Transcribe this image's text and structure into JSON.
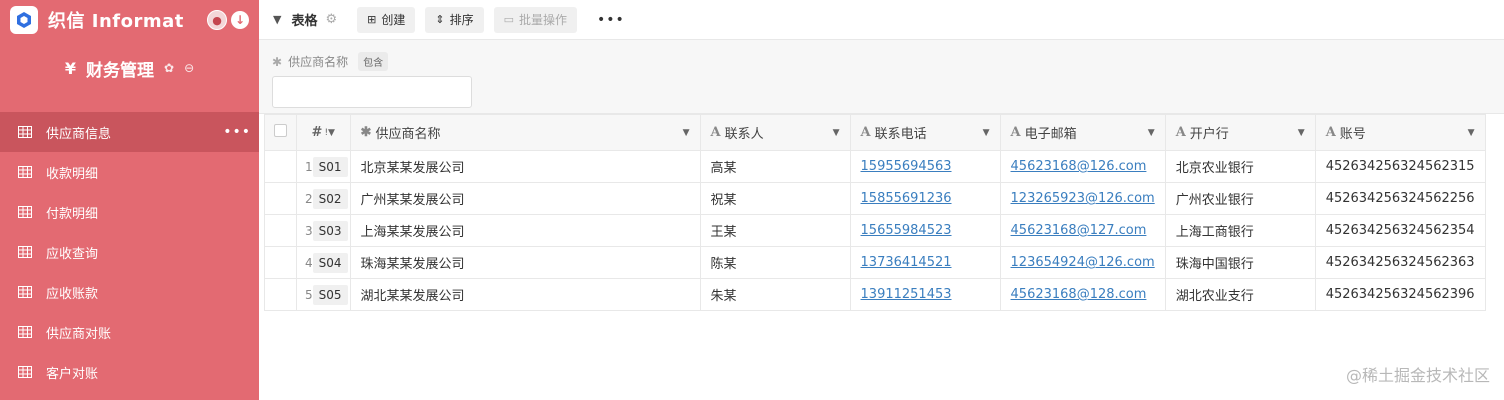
{
  "app": {
    "brand": "织信 Informat",
    "colors": {
      "sidebar": "#e36a72",
      "sidebar_active": "#c9555d",
      "link": "#3a7ebf"
    }
  },
  "sidebar": {
    "module_symbol": "¥",
    "module_title": "财务管理",
    "items": [
      {
        "label": "供应商信息",
        "active": true
      },
      {
        "label": "收款明细"
      },
      {
        "label": "付款明细"
      },
      {
        "label": "应收查询"
      },
      {
        "label": "应收账款"
      },
      {
        "label": "供应商对账"
      },
      {
        "label": "客户对账"
      }
    ]
  },
  "toolbar": {
    "title": "表格",
    "create_label": "创建",
    "sort_label": "排序",
    "batch_label": "批量操作",
    "more_label": "•••"
  },
  "filter": {
    "field_label": "供应商名称",
    "operator": "包含",
    "value": ""
  },
  "table": {
    "headers": {
      "num": "#",
      "name": "供应商名称",
      "contact": "联系人",
      "phone": "联系电话",
      "email": "电子邮箱",
      "bank": "开户行",
      "account": "账号"
    },
    "rows": [
      {
        "n": "1",
        "id": "S01",
        "name": "北京某某发展公司",
        "contact": "高某",
        "phone": "15955694563",
        "email": "45623168@126.com",
        "bank": "北京农业银行",
        "account": "452634256324562315"
      },
      {
        "n": "2",
        "id": "S02",
        "name": "广州某某发展公司",
        "contact": "祝某",
        "phone": "15855691236",
        "email": "123265923@126.com",
        "bank": "广州农业银行",
        "account": "452634256324562256"
      },
      {
        "n": "3",
        "id": "S03",
        "name": "上海某某发展公司",
        "contact": "王某",
        "phone": "15655984523",
        "email": "45623168@127.com",
        "bank": "上海工商银行",
        "account": "452634256324562354"
      },
      {
        "n": "4",
        "id": "S04",
        "name": "珠海某某发展公司",
        "contact": "陈某",
        "phone": "13736414521",
        "email": "123654924@126.com",
        "bank": "珠海中国银行",
        "account": "452634256324562363"
      },
      {
        "n": "5",
        "id": "S05",
        "name": "湖北某某发展公司",
        "contact": "朱某",
        "phone": "13911251453",
        "email": "45623168@128.com",
        "bank": "湖北农业支行",
        "account": "452634256324562396"
      }
    ]
  },
  "watermark": "@稀土掘金技术社区"
}
